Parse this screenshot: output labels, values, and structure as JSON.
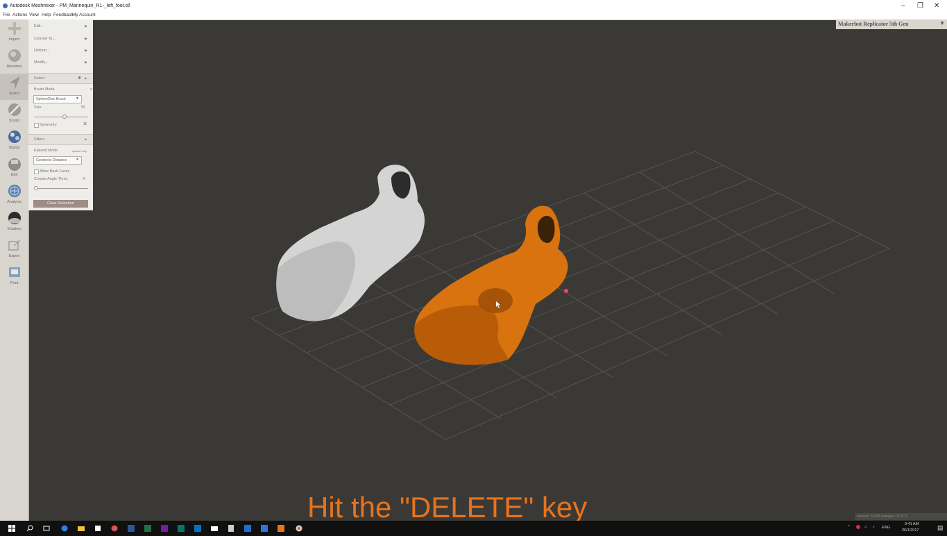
{
  "window": {
    "title": "Autodesk Meshmixer - PM_Mannequin_R1-_left_foot.stl",
    "minimize_glyph": "–",
    "restore_glyph": "❐",
    "close_glyph": "✕"
  },
  "menu": [
    "File",
    "Actions",
    "View",
    "Help",
    "Feedback",
    "My Account"
  ],
  "toolbar": [
    {
      "label": "Import",
      "icon": "import-icon"
    },
    {
      "label": "Meshmix",
      "icon": "meshmix-icon"
    },
    {
      "label": "Select",
      "icon": "select-icon",
      "active": true
    },
    {
      "label": "Sculpt",
      "icon": "sculpt-icon"
    },
    {
      "label": "Stamp",
      "icon": "stamp-icon"
    },
    {
      "label": "Edit",
      "icon": "edit-icon"
    },
    {
      "label": "Analysis",
      "icon": "analysis-icon"
    },
    {
      "label": "Shaders",
      "icon": "shaders-icon"
    },
    {
      "label": "Export",
      "icon": "export-icon"
    },
    {
      "label": "Print",
      "icon": "print-icon"
    }
  ],
  "panel": {
    "submenus": [
      "Edit...",
      "Convert To...",
      "Deform...",
      "Modify..."
    ],
    "select": {
      "header": "Select",
      "brush_mode_label": "Brush Mode",
      "brush_mode_side": "s",
      "brush_mode_value": "SphereDisc Brush",
      "size_label": "Size",
      "size_value": "55",
      "size_level": 0.55,
      "symmetry_label": "Symmetry"
    },
    "filters": {
      "header": "Filters",
      "expand_mode_label": "Expand Mode",
      "expand_mode_side": "sphere-only",
      "expand_mode_value": "Geodesic Distance",
      "allow_back_faces_label": "Allow Back Faces",
      "crease_angle_label": "Crease Angle Thres",
      "crease_angle_value": "0",
      "crease_level": 0.0
    },
    "clear_selection_label": "Clear Selection"
  },
  "printer": {
    "name": "Makerbot Replicator 5th Gen"
  },
  "status": {
    "stats": "vertices: 56158 triangles: 112271"
  },
  "caption": "Hit the \"DELETE\" key",
  "taskbar": {
    "apps": [
      "windows-icon",
      "search-icon",
      "task-view-icon",
      "edge-icon",
      "explorer-icon",
      "store-icon",
      "chrome-icon",
      "word-icon",
      "excel-icon",
      "onenote-icon",
      "publisher-icon",
      "outlook-icon",
      "mail-icon",
      "calculator-icon",
      "app-icon",
      "app-icon",
      "meshmixer-icon"
    ],
    "tray_lang": "ENG",
    "time": "9:41 AM",
    "date": "26/1/2017"
  },
  "colors": {
    "viewport_bg": "#3b3936",
    "selection": "#e07a14",
    "caption": "#e8731c",
    "white_model": "#d9d9d9"
  }
}
